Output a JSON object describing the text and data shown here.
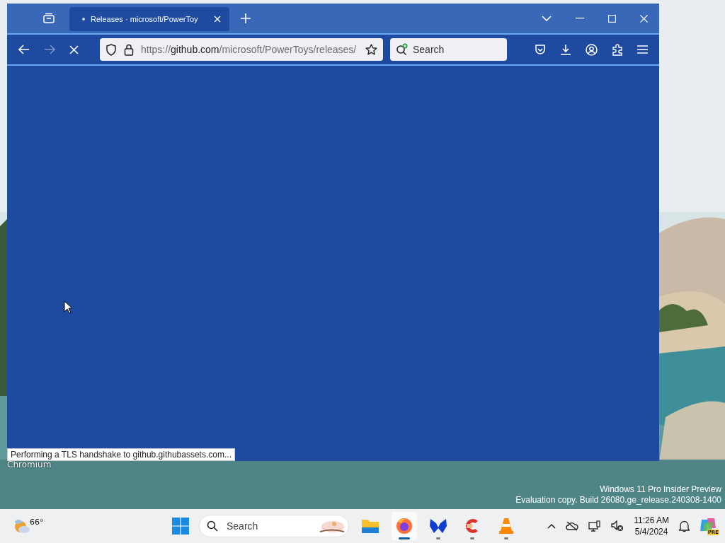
{
  "browser": {
    "tabs": [
      {
        "title": "Releases · microsoft/PowerToy",
        "selected": true,
        "loading": true
      }
    ],
    "navigation": {
      "back_disabled": false,
      "forward_disabled": true,
      "loading": true
    },
    "address": {
      "scheme": "https://",
      "host": "github.com",
      "path": "/microsoft/PowerToys/releases/"
    },
    "search": {
      "placeholder": "Search"
    },
    "status": "Performing a TLS handshake to github.githubassets.com..."
  },
  "desktop_icons": [
    {
      "label": "Chromium"
    }
  ],
  "os_notice": [
    "Windows 11 Pro Insider Preview",
    "Evaluation copy. Build 26080.ge_release.240308-1400"
  ],
  "taskbar": {
    "weather": "66°",
    "search": {
      "placeholder": "Search"
    },
    "apps": [
      {
        "kind": "files",
        "selected": false,
        "running": false
      },
      {
        "kind": "firefox",
        "selected": true,
        "running": true
      },
      {
        "kind": "malwarebytes",
        "selected": false,
        "running": true
      },
      {
        "kind": "ccleaner",
        "selected": false,
        "running": true
      },
      {
        "kind": "vlc",
        "selected": false,
        "running": true
      }
    ],
    "clock": {
      "time": "11:26 AM",
      "date": "5/4/2024"
    },
    "copilot_badge": "PRE"
  }
}
